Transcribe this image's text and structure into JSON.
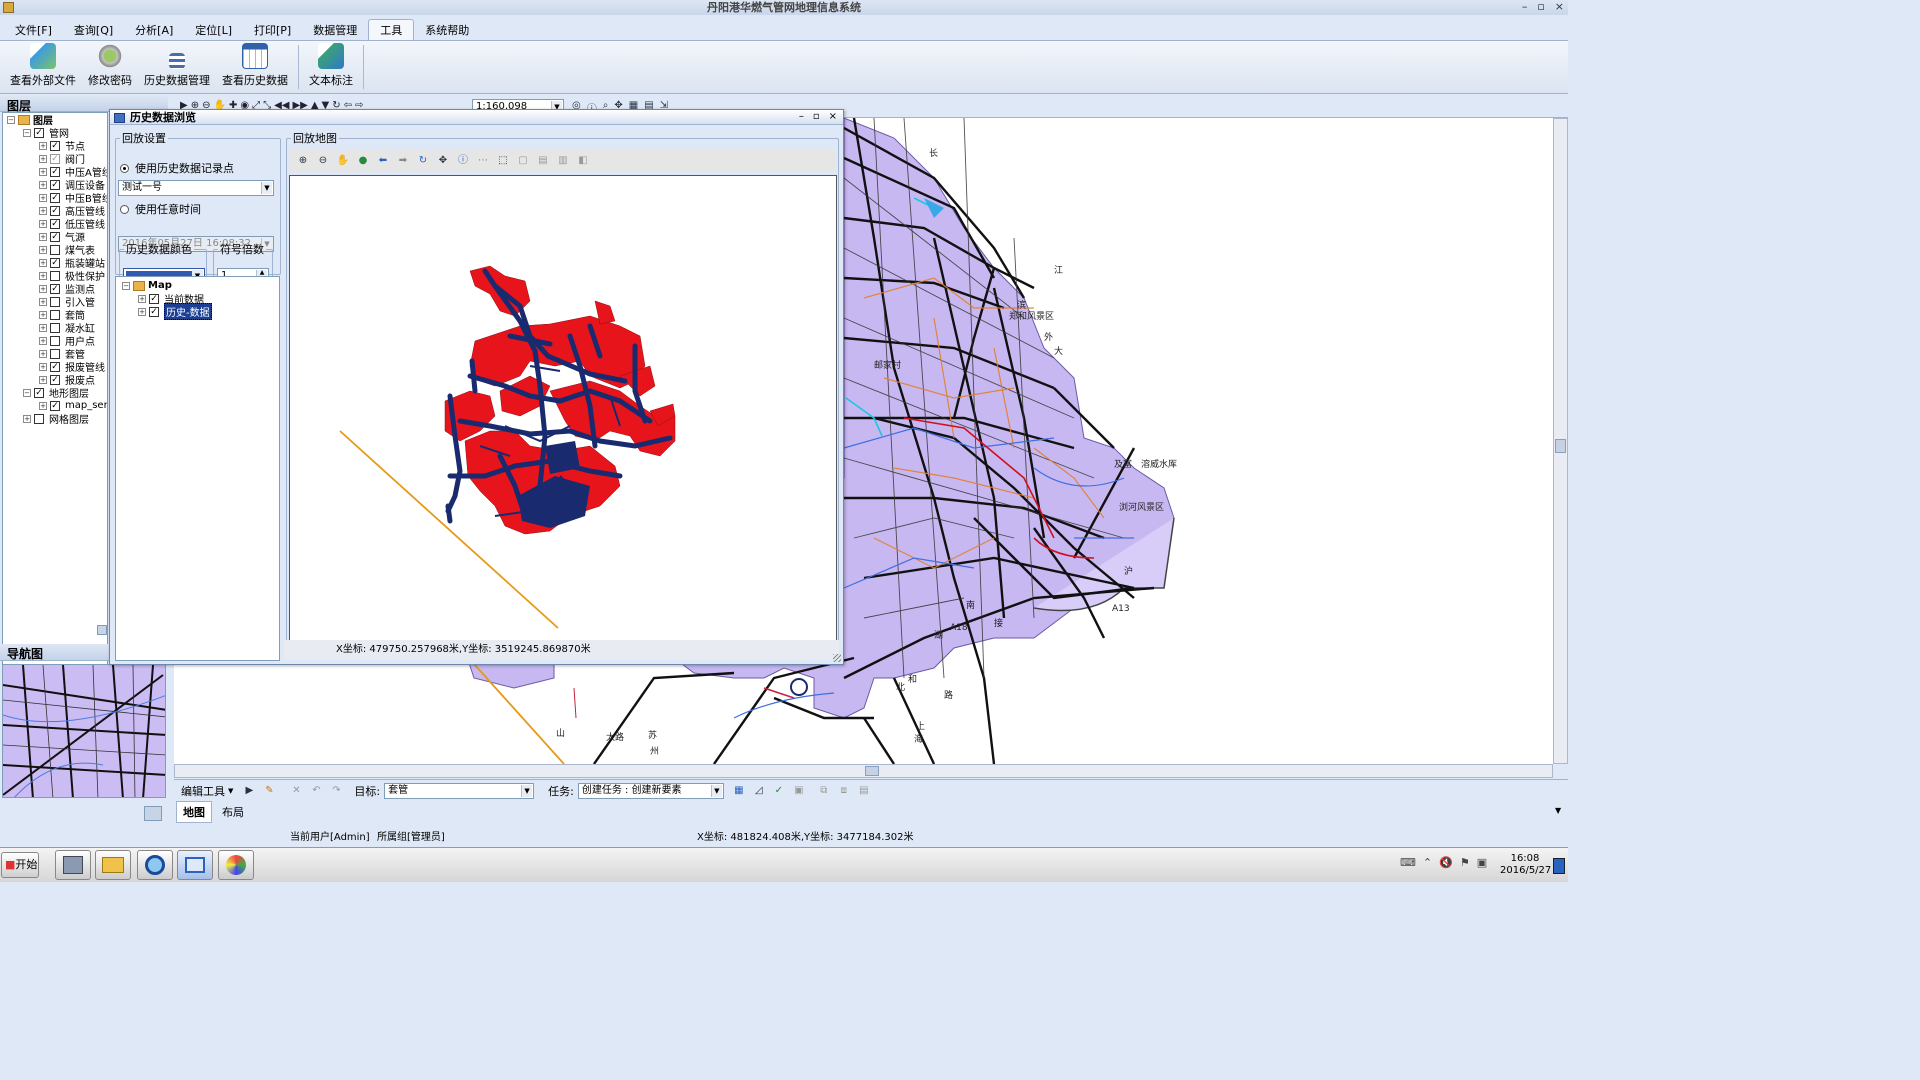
{
  "app": {
    "title": "丹阳港华燃气管网地理信息系统",
    "window_controls": [
      "–",
      "▫",
      "×"
    ]
  },
  "menu": [
    "文件[F]",
    "查询[Q]",
    "分析[A]",
    "定位[L]",
    "打印[P]",
    "数据管理",
    "工具",
    "系统帮助"
  ],
  "menu_active": "工具",
  "ribbon": [
    {
      "label": "查看外部文件",
      "icon": "external-file-icon",
      "color": "#3d9be0"
    },
    {
      "label": "修改密码",
      "icon": "password-gear-icon",
      "color": "#6b9c3a"
    },
    {
      "label": "历史数据管理",
      "icon": "history-manage-icon",
      "color": "#4a6fa8"
    },
    {
      "label": "查看历史数据",
      "icon": "history-view-icon",
      "color": "#2f62a8"
    },
    {
      "label": "文本标注",
      "icon": "text-annotation-icon",
      "color": "#3aa07a"
    }
  ],
  "left": {
    "layers_title": "图层",
    "nav_title": "导航图",
    "tree": [
      {
        "label": "图层",
        "level": 0,
        "pm": "−",
        "check": null,
        "folder": true
      },
      {
        "label": "管网",
        "level": 1,
        "pm": "−",
        "check": "checked"
      },
      {
        "label": "节点",
        "level": 2,
        "pm": "+",
        "check": "checked"
      },
      {
        "label": "阀门",
        "level": 2,
        "pm": "+",
        "check": "partial"
      },
      {
        "label": "中压A管线",
        "level": 2,
        "pm": "+",
        "check": "checked"
      },
      {
        "label": "调压设备",
        "level": 2,
        "pm": "+",
        "check": "checked"
      },
      {
        "label": "中压B管线",
        "level": 2,
        "pm": "+",
        "check": "checked"
      },
      {
        "label": "高压管线",
        "level": 2,
        "pm": "+",
        "check": "checked"
      },
      {
        "label": "低压管线",
        "level": 2,
        "pm": "+",
        "check": "checked"
      },
      {
        "label": "气源",
        "level": 2,
        "pm": "+",
        "check": "checked"
      },
      {
        "label": "煤气表",
        "level": 2,
        "pm": "+",
        "check": "unchecked"
      },
      {
        "label": "瓶装罐站",
        "level": 2,
        "pm": "+",
        "check": "checked"
      },
      {
        "label": "极性保护",
        "level": 2,
        "pm": "+",
        "check": "unchecked"
      },
      {
        "label": "监测点",
        "level": 2,
        "pm": "+",
        "check": "checked"
      },
      {
        "label": "引入管",
        "level": 2,
        "pm": "+",
        "check": "unchecked"
      },
      {
        "label": "套筒",
        "level": 2,
        "pm": "+",
        "check": "unchecked"
      },
      {
        "label": "凝水缸",
        "level": 2,
        "pm": "+",
        "check": "unchecked"
      },
      {
        "label": "用户点",
        "level": 2,
        "pm": "+",
        "check": "unchecked"
      },
      {
        "label": "套管",
        "level": 2,
        "pm": "+",
        "check": "unchecked"
      },
      {
        "label": "报废管线",
        "level": 2,
        "pm": "+",
        "check": "checked"
      },
      {
        "label": "报废点",
        "level": 2,
        "pm": "+",
        "check": "checked"
      },
      {
        "label": "地形图层",
        "level": 1,
        "pm": "−",
        "check": "checked"
      },
      {
        "label": "map_server",
        "level": 2,
        "pm": "+",
        "check": "checked"
      },
      {
        "label": "网格图层",
        "level": 1,
        "pm": "+",
        "check": "unchecked"
      }
    ]
  },
  "map_toolbar": {
    "scale": "1:160,098"
  },
  "map_labels": [
    "长",
    "江",
    "滨",
    "郑和风景区",
    "外",
    "大",
    "邮家村",
    "及富",
    "溶威水厍",
    "浏河风景区",
    "A13",
    "A18",
    "沪",
    "接",
    "上",
    "海",
    "路",
    "太路",
    "苏",
    "州",
    "山",
    "北",
    "和",
    "湖",
    "南"
  ],
  "dialog": {
    "title": "历史数据浏览",
    "window_controls": [
      "–",
      "▫",
      "×"
    ],
    "playback_legend": "回放设置",
    "radio_record": "使用历史数据记录点",
    "radio_record_on": true,
    "record_select": "测试一号",
    "radio_time": "使用任意时间",
    "time_value": "2016年05月27日  16:08:32",
    "color_label": "历史数据颜色",
    "color_value": "#2f5bb0",
    "symbol_label": "符号倍数",
    "symbol_value": "1",
    "layer_tree": [
      {
        "label": "Map",
        "level": 0,
        "pm": "−",
        "check": null,
        "folder": true
      },
      {
        "label": "当前数据",
        "level": 1,
        "pm": "+",
        "check": "checked"
      },
      {
        "label": "历史-数据",
        "level": 1,
        "pm": "+",
        "check": "checked",
        "selected": true
      }
    ],
    "map_legend": "回放地图",
    "coords": "X坐标: 479750.257968米,Y坐标: 3519245.869870米"
  },
  "edit_bar": {
    "edit_tools": "编辑工具",
    "target_label": "目标:",
    "target_value": "套管",
    "task_label": "任务:",
    "task_value": "创建任务 : 创建新要素"
  },
  "tabs": [
    "地图",
    "布局"
  ],
  "tab_active": "地图",
  "status": {
    "user": "当前用户[Admin]",
    "group": "所属组[管理员]",
    "coords": "X坐标: 481824.408米,Y坐标: 3477184.302米"
  },
  "taskbar": {
    "start": "开始",
    "time": "16:08",
    "date": "2016/5/27"
  },
  "colors": {
    "pipe_red": "#e8141c",
    "pipe_navy": "#1a2a6e",
    "district_purple": "#c8b8f2",
    "road_black": "#111111",
    "line_orange": "#e69a16"
  }
}
